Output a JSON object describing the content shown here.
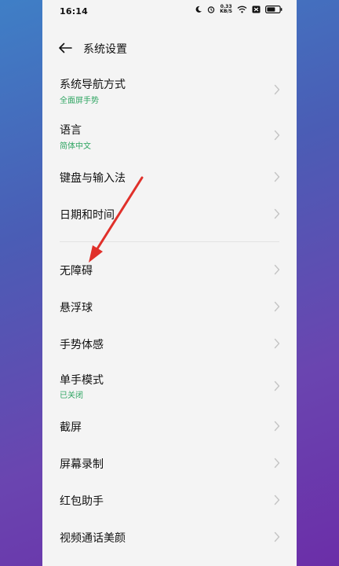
{
  "status_bar": {
    "time": "16:14",
    "net_speed_value": "0.33",
    "net_speed_unit": "KB/S",
    "icons": [
      "moon-icon",
      "alarm-icon",
      "wifi-icon",
      "sim-icon",
      "battery-icon"
    ]
  },
  "header": {
    "back_icon": "back-arrow-icon",
    "title": "系统设置"
  },
  "settings_items": [
    {
      "title": "系统导航方式",
      "subtitle": "全面屏手势"
    },
    {
      "title": "语言",
      "subtitle": "简体中文"
    },
    {
      "title": "键盘与输入法"
    },
    {
      "title": "日期和时间"
    },
    {
      "title": "无障碍"
    },
    {
      "title": "悬浮球"
    },
    {
      "title": "手势体感"
    },
    {
      "title": "单手模式",
      "subtitle": "已关闭"
    },
    {
      "title": "截屏"
    },
    {
      "title": "屏幕录制"
    },
    {
      "title": "红包助手"
    },
    {
      "title": "视频通话美颜"
    }
  ],
  "colors": {
    "subtitle_green": "#2fa562",
    "annotation_red": "#e0302a",
    "panel_bg": "#f4f4f4"
  }
}
